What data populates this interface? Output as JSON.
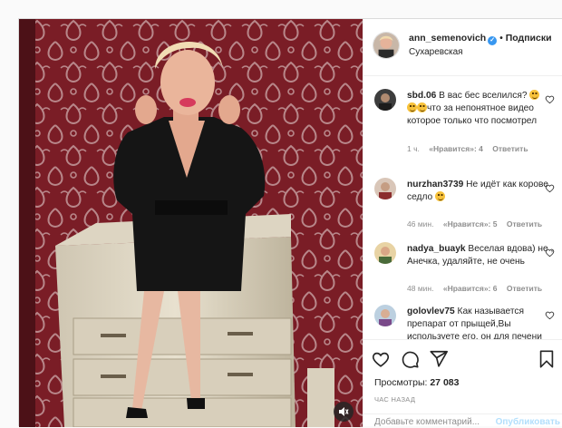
{
  "post": {
    "media": {
      "alt_icon": "speaker-icon",
      "bg_color": "#6d1b22"
    },
    "header": {
      "username": "ann_semenovich",
      "separator": "•",
      "follow_label": "Подписки",
      "location": "Сухаревская",
      "verified_icon": "verified-badge-icon"
    },
    "comments": [
      {
        "username": "sbd.06",
        "text_a": "В вас бес вселился?",
        "text_b": "что за непонятное видео которое только что посмотрел",
        "time": "1 ч.",
        "likes": "«Нравится»: 4",
        "reply": "Ответить"
      },
      {
        "username": "nurzhan3739",
        "text_a": "Не идёт как корове седло",
        "text_b": "",
        "time": "46 мин.",
        "likes": "«Нравится»: 5",
        "reply": "Ответить"
      },
      {
        "username": "nadya_buayk",
        "text_a": "Веселая вдова) не , Анечка, удаляйте, не очень",
        "text_b": "",
        "time": "48 мин.",
        "likes": "«Нравится»: 6",
        "reply": "Ответить"
      },
      {
        "username": "golovlev75",
        "text_a": "Как называется препарат от прыщей,Вы используете его, он для печени",
        "text_b": "",
        "time": "",
        "likes": "",
        "reply": ""
      }
    ],
    "actions": {
      "like_icon": "heart-icon",
      "comment_icon": "comment-icon",
      "share_icon": "share-icon",
      "save_icon": "bookmark-icon",
      "views_label": "Просмотры:",
      "views_count": "27 083",
      "time_ago": "ЧАС НАЗАД",
      "comment_placeholder": "Добавьте комментарий...",
      "publish_label": "Опубликовать"
    }
  }
}
